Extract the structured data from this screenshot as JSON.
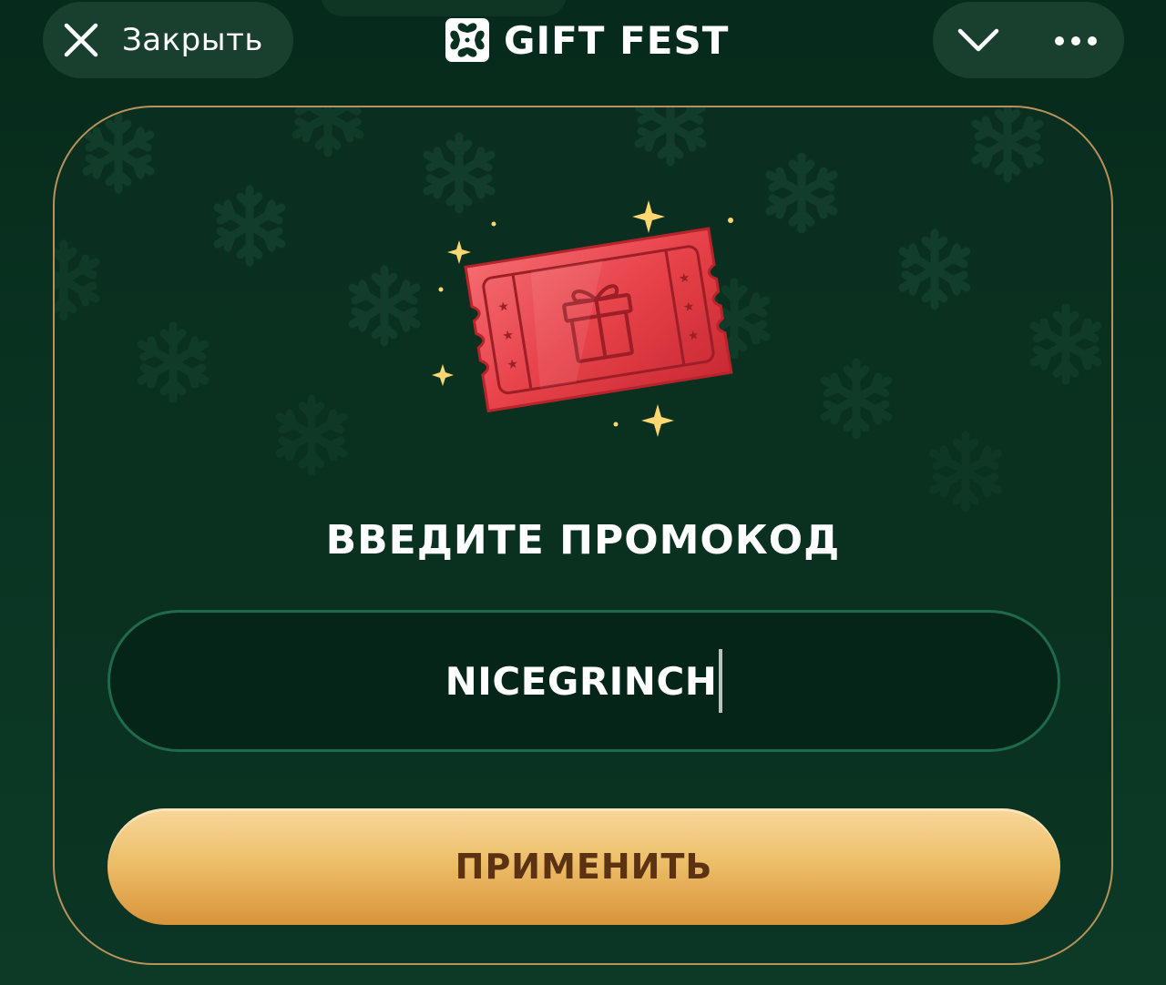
{
  "header": {
    "close_label": "Закрыть",
    "brand_name": "GIFT FEST",
    "icons": {
      "close": "close-icon",
      "logo": "gift-logo-icon",
      "collapse": "chevron-down-icon",
      "more": "more-dots-icon"
    }
  },
  "promo": {
    "title": "ВВЕДИТЕ ПРОМОКОД",
    "input_value": "NICEGRINCH",
    "apply_label": "ПРИМЕНИТЬ",
    "illustration": "gift-ticket-icon"
  },
  "colors": {
    "background": "#0a3020",
    "card_border": "#b8925a",
    "input_border": "#1f6a4a",
    "button_gold": "#edbf6a",
    "button_text": "#5b3313",
    "ticket_red": "#e8424a"
  }
}
